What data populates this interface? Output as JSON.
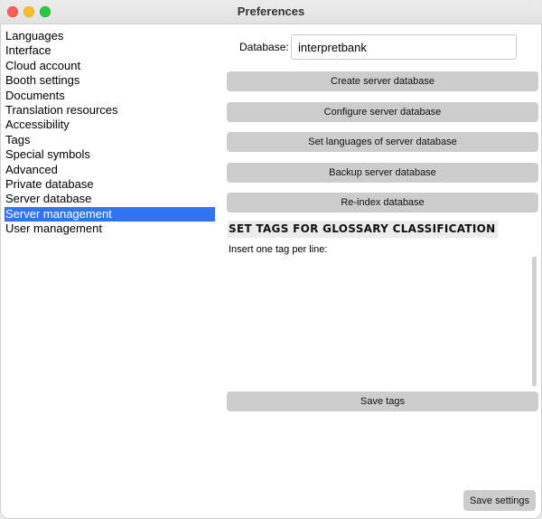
{
  "window": {
    "title": "Preferences"
  },
  "sidebar": {
    "items": [
      {
        "label": "Languages"
      },
      {
        "label": "Interface"
      },
      {
        "label": "Cloud account"
      },
      {
        "label": "Booth settings"
      },
      {
        "label": "Documents"
      },
      {
        "label": "Translation resources"
      },
      {
        "label": "Accessibility"
      },
      {
        "label": "Tags"
      },
      {
        "label": "Special symbols"
      },
      {
        "label": "Advanced"
      },
      {
        "label": "Private database"
      },
      {
        "label": "Server database"
      },
      {
        "label": "Server management",
        "selected": true
      },
      {
        "label": "User management"
      }
    ]
  },
  "main": {
    "database_label": "Database:",
    "database_value": "interpretbank",
    "buttons": {
      "create": "Create server database",
      "configure": "Configure server database",
      "languages": "Set languages of server database",
      "backup": "Backup server database",
      "reindex": "Re-index database",
      "save_tags": "Save tags"
    },
    "tags_section": {
      "title": "SET TAGS FOR GLOSSARY CLASSIFICATION",
      "hint": "Insert one tag per line:",
      "content": ""
    }
  },
  "footer": {
    "save_settings": "Save settings"
  },
  "colors": {
    "selection": "#3174f1",
    "button_bg": "#cdcdcd",
    "close": "#fe5f57",
    "minimize": "#febc2e",
    "maximize": "#28c840"
  }
}
